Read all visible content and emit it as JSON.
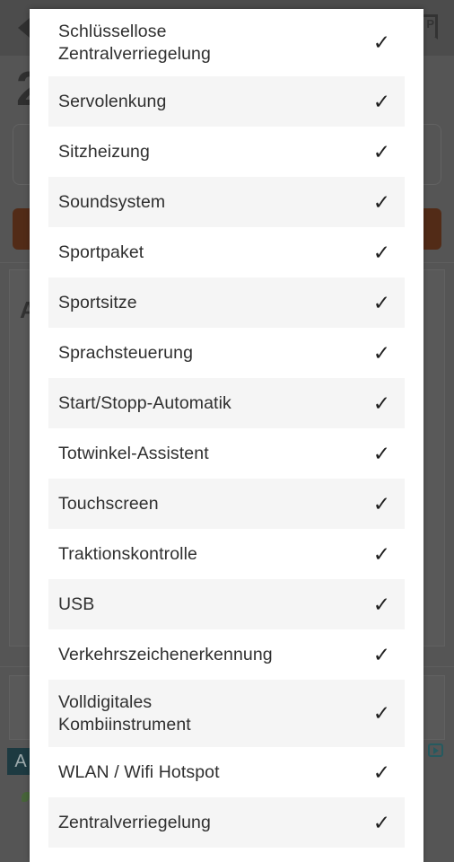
{
  "background": {
    "back_icon": "back-arrow-icon",
    "bookmark_icon": "bookmark-icon",
    "bookmark_letter": "P",
    "price": "2",
    "section_letter": "A",
    "ad_badge_letter": "A",
    "adchoices_icon": "adchoices-icon",
    "cta_color": "#5e2406",
    "scrim_color": "#636363"
  },
  "panel": {
    "check_glyph": "✓",
    "stripe_color": "#f5f5f5",
    "surface_color": "#ffffff",
    "items": [
      {
        "label": "Schlüssellose\nZentralverriegelung",
        "checked": true,
        "two_line": true
      },
      {
        "label": "Servolenkung",
        "checked": true,
        "two_line": false
      },
      {
        "label": "Sitzheizung",
        "checked": true,
        "two_line": false
      },
      {
        "label": "Soundsystem",
        "checked": true,
        "two_line": false
      },
      {
        "label": "Sportpaket",
        "checked": true,
        "two_line": false
      },
      {
        "label": "Sportsitze",
        "checked": true,
        "two_line": false
      },
      {
        "label": "Sprachsteuerung",
        "checked": true,
        "two_line": false
      },
      {
        "label": "Start/Stopp-Automatik",
        "checked": true,
        "two_line": false
      },
      {
        "label": "Totwinkel-Assistent",
        "checked": true,
        "two_line": false
      },
      {
        "label": "Touchscreen",
        "checked": true,
        "two_line": false
      },
      {
        "label": "Traktionskontrolle",
        "checked": true,
        "two_line": false
      },
      {
        "label": "USB",
        "checked": true,
        "two_line": false
      },
      {
        "label": "Verkehrszeichenerkennung",
        "checked": true,
        "two_line": false
      },
      {
        "label": "Volldigitales\nKombiinstrument",
        "checked": true,
        "two_line": true
      },
      {
        "label": "WLAN / Wifi Hotspot",
        "checked": true,
        "two_line": false
      },
      {
        "label": "Zentralverriegelung",
        "checked": true,
        "two_line": false
      }
    ]
  }
}
